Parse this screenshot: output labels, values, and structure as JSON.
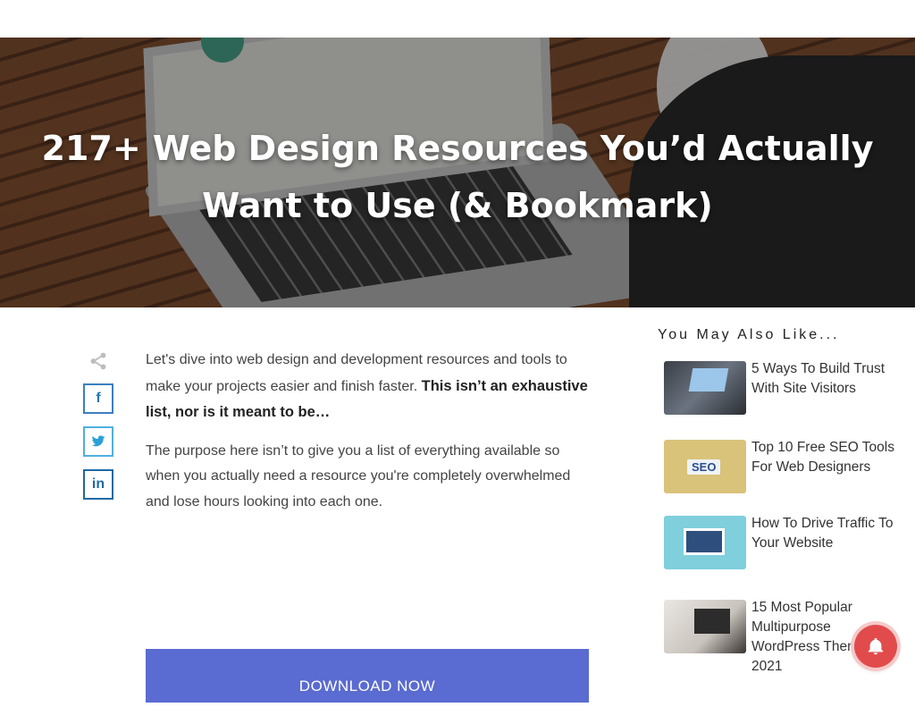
{
  "hero": {
    "title": "217+ Web Design Resources You’d Actually Want to Use (& Bookmark)"
  },
  "share": {
    "facebook_label": "f",
    "twitter_label": "twitter",
    "linkedin_label": "in"
  },
  "article": {
    "para1_normal": "Let's dive into web design and development resources and tools to make your projects easier and finish faster.",
    "para1_bold": "This isn’t an exhaustive list, nor is it meant to be…",
    "para2": "The purpose here isn’t to give you a list of everything available so when you actually need a resource you're completely overwhelmed and lose hours looking into each one.",
    "download_label": "DOWNLOAD NOW"
  },
  "sidebar": {
    "title": "You May Also Like...",
    "posts": [
      {
        "title": "5 Ways To Build Trust With Site Visitors"
      },
      {
        "title": "Top 10 Free SEO Tools For Web Designers"
      },
      {
        "title": "How To Drive Traffic To Your Website"
      },
      {
        "title": "15 Most Popular Multipurpose WordPress Themes Of 2021"
      }
    ]
  },
  "colors": {
    "download_bg": "#5a6bd1",
    "facebook": "#3d7fbf",
    "twitter": "#4fb0e0",
    "linkedin": "#1f6aa5",
    "notify": "#e24b4b"
  }
}
